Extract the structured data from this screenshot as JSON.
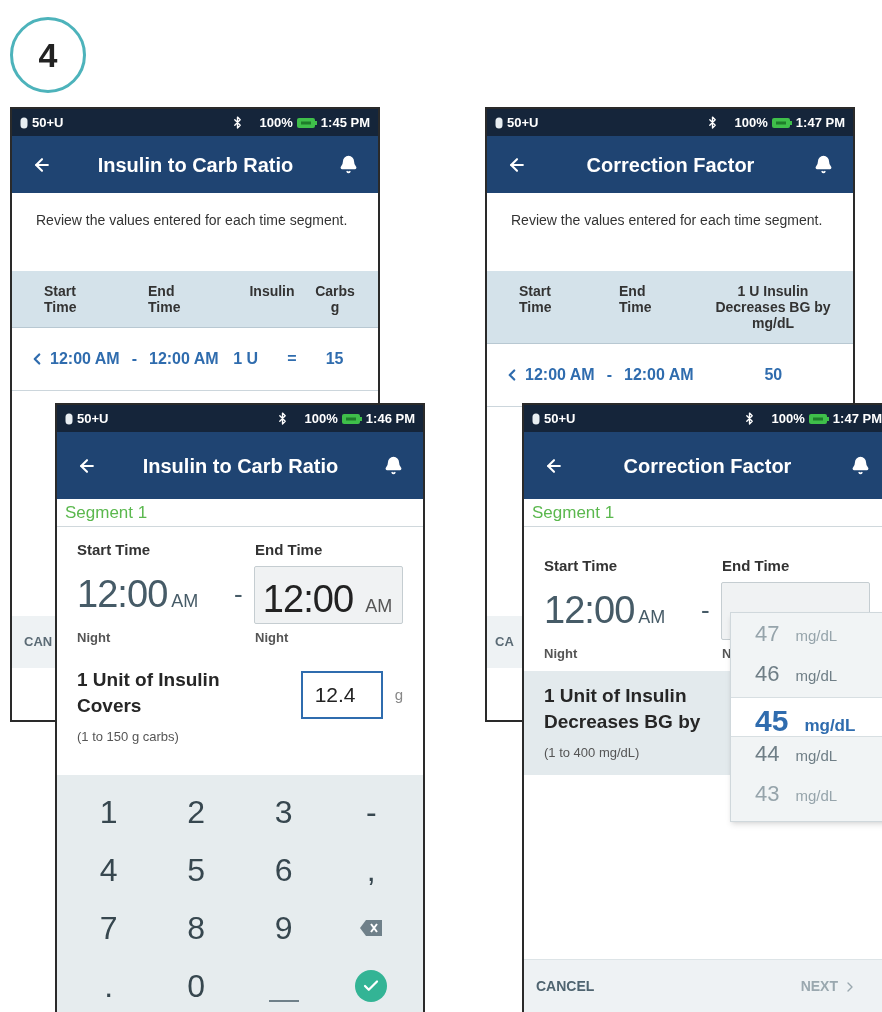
{
  "step_badge": "4",
  "screens": [
    {
      "kind": "review",
      "status": {
        "carrier": "50+U",
        "battery": "100%",
        "time": "1:45 PM"
      },
      "title": "Insulin to Carb Ratio",
      "intro": "Review the values entered for each time segment.",
      "columns": [
        "Start\nTime",
        "End\nTime",
        "Insulin",
        "Carbs\ng"
      ],
      "row": {
        "start": "12:00 AM",
        "separator": "-",
        "end": "12:00 AM",
        "values": [
          "1 U",
          "=",
          "15"
        ]
      },
      "footer_left": "CAN"
    },
    {
      "kind": "editor",
      "status": {
        "carrier": "50+U",
        "battery": "100%",
        "time": "1:46 PM"
      },
      "title": "Insulin to Carb Ratio",
      "segment": "Segment 1",
      "start_label": "Start Time",
      "end_label": "End Time",
      "start_time": "12:00",
      "start_ampm": "AM",
      "separator": "-",
      "end_time": "12:00",
      "end_ampm": "AM",
      "start_period": "Night",
      "end_period": "Night",
      "prompt": "1 Unit of Insulin\nCovers",
      "hint": "(1 to 150 g carbs)",
      "highlighted": false,
      "input": {
        "value": "12.4",
        "unit": "g"
      },
      "keypad": [
        {
          "kind": "char",
          "label": "1"
        },
        {
          "kind": "char",
          "label": "2"
        },
        {
          "kind": "char",
          "label": "3"
        },
        {
          "kind": "char",
          "label": "-"
        },
        {
          "kind": "char",
          "label": "4"
        },
        {
          "kind": "char",
          "label": "5"
        },
        {
          "kind": "char",
          "label": "6"
        },
        {
          "kind": "char",
          "label": ","
        },
        {
          "kind": "char",
          "label": "7"
        },
        {
          "kind": "char",
          "label": "8"
        },
        {
          "kind": "char",
          "label": "9"
        },
        {
          "kind": "backspace"
        },
        {
          "kind": "char",
          "label": "."
        },
        {
          "kind": "char",
          "label": "0"
        },
        {
          "kind": "space"
        },
        {
          "kind": "done"
        }
      ]
    },
    {
      "kind": "review",
      "status": {
        "carrier": "50+U",
        "battery": "100%",
        "time": "1:47 PM"
      },
      "title": "Correction Factor",
      "intro": "Review the values entered for each time segment.",
      "columns": [
        "Start\nTime",
        "End\nTime",
        "1 U Insulin\nDecreases BG by\nmg/dL"
      ],
      "row": {
        "start": "12:00 AM",
        "separator": "-",
        "end": "12:00 AM",
        "values": [
          "50"
        ]
      },
      "footer_left": "CA"
    },
    {
      "kind": "editor",
      "status": {
        "carrier": "50+U",
        "battery": "100%",
        "time": "1:47 PM"
      },
      "title": "Correction Factor",
      "segment": "Segment 1",
      "start_label": "Start Time",
      "end_label": "End Time",
      "start_time": "12:00",
      "start_ampm": "AM",
      "separator": "-",
      "end_period_cut": "N",
      "start_period": "Night",
      "prompt": "1 Unit of Insulin\nDecreases BG by",
      "hint": "(1 to 400 mg/dL)",
      "highlighted": true,
      "picker": [
        {
          "value": "47",
          "unit": "mg/dL",
          "selected": false
        },
        {
          "value": "46",
          "unit": "mg/dL",
          "selected": false
        },
        {
          "value": "45",
          "unit": "mg/dL",
          "selected": true
        },
        {
          "value": "44",
          "unit": "mg/dL",
          "selected": false
        },
        {
          "value": "43",
          "unit": "mg/dL",
          "selected": false
        }
      ],
      "footer": {
        "cancel": "CANCEL",
        "next": "NEXT",
        "next_disabled": true
      }
    }
  ]
}
